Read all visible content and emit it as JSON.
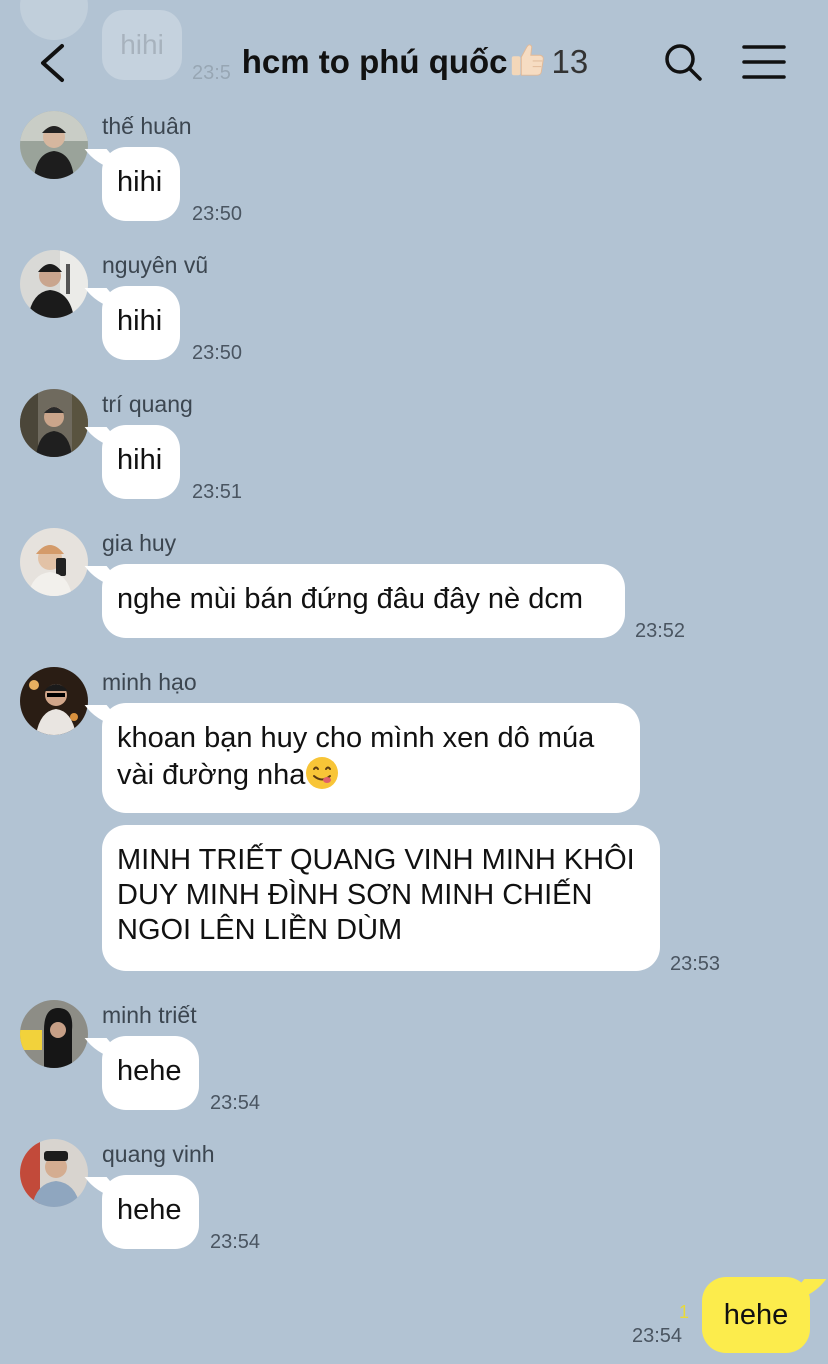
{
  "header": {
    "title": "hcm to phú quốc",
    "member_count": "13",
    "icons": {
      "back": "chevron-left-icon",
      "search": "search-icon",
      "menu": "hamburger-menu-icon",
      "title_emoji": "thumbs-up-emoji"
    }
  },
  "ghost": {
    "text": "hihi",
    "time": "23:5"
  },
  "messages": [
    {
      "sender": "thế huân",
      "text": "hihi",
      "time": "23:50"
    },
    {
      "sender": "nguyên vũ",
      "text": "hihi",
      "time": "23:50"
    },
    {
      "sender": "trí quang",
      "text": "hihi",
      "time": "23:51"
    },
    {
      "sender": "gia huy",
      "text": "nghe mùi bán đứng đâu đây nè dcm",
      "time": "23:52"
    },
    {
      "sender": "minh hạo",
      "text": "khoan bạn huy cho mình xen dô múa\nvài đường nha",
      "text2": "MINH TRIẾT QUANG VINH MINH KHÔI\nDUY MINH ĐÌNH SƠN MINH CHIẾN\nNGOI LÊN LIỀN DÙM",
      "time": "23:53",
      "emoji": "smiling-face-savoring-food-emoji"
    },
    {
      "sender": "minh triết",
      "text": "hehe",
      "time": "23:54"
    },
    {
      "sender": "quang vinh",
      "text": "hehe",
      "time": "23:54"
    }
  ],
  "my_message": {
    "text": "hehe",
    "time": "23:54",
    "unread": "1"
  },
  "colors": {
    "background": "#b2c3d3",
    "my_bubble": "#fcec4c",
    "bubble": "#ffffff",
    "unread": "#e8d93a"
  }
}
